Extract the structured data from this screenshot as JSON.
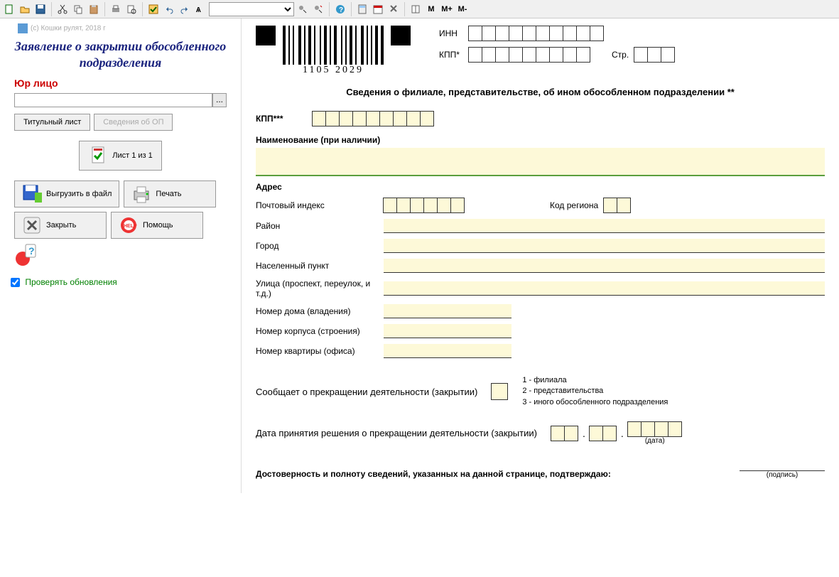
{
  "copyright": "(с) Кошки рулят, 2018 г",
  "title_main": "Заявление о закрытии обособленного подразделения",
  "title_sub": "Юр лицо",
  "buttons": {
    "title_sheet": "Титульный лист",
    "op_info": "Сведения об ОП",
    "sheet_counter": "Лист 1 из 1",
    "export": "Выгрузить в файл",
    "print": "Печать",
    "close": "Закрыть",
    "help": "Помощь"
  },
  "check_updates": "Проверять обновления",
  "barcode_number": "1105  2029",
  "header": {
    "inn": "ИНН",
    "kpp": "КПП*",
    "page": "Стр."
  },
  "form_title": "Сведения о филиале, представительстве, об ином обособленном подразделении **",
  "fields": {
    "kpp3": "КПП***",
    "name_label": "Наименование (при наличии)",
    "address": "Адрес",
    "postal": "Почтовый индекс",
    "region": "Код региона",
    "district": "Район",
    "city": "Город",
    "locality": "Населенный пункт",
    "street": "Улица (проспект, переулок, и т.д.)",
    "house": "Номер дома (владения)",
    "building": "Номер корпуса (строения)",
    "apt": "Номер квартиры (офиса)",
    "closure": "Сообщает о прекращении деятельности (закрытии)",
    "legend1": "1 - филиала",
    "legend2": "2 - представительства",
    "legend3": "3 - иного обособленного подразделения",
    "decision_date": "Дата принятия решения о прекращении деятельности (закрытии)",
    "date_caption": "(дата)",
    "confirm": "Достоверность и полноту сведений, указанных на данной странице, подтверждаю:",
    "signature": "(подпись)"
  },
  "toolbar": {
    "m": "M",
    "mp": "M+",
    "mm": "M-"
  }
}
